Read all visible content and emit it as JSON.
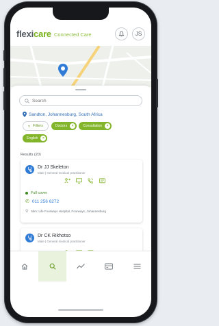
{
  "app": {
    "brand_flexi": "flexi",
    "brand_care": "care",
    "brand_sub": "Connected Care",
    "user_initials": "JS"
  },
  "search": {
    "placeholder": "Search",
    "value": ""
  },
  "location": {
    "text": "Sandton, Johannesburg, South Africa"
  },
  "filters": {
    "button_label": "Filters",
    "active_chips": [
      "Doctors",
      "Consultation",
      "English"
    ]
  },
  "results": {
    "label": "Results (20)"
  },
  "doctors": [
    {
      "name": "Dr JJ Skeleton",
      "subtitle": "Male | General medical practitioner",
      "cover": "Full cover",
      "phone": "011 256 6272",
      "address": "5km: Life Fourways Hospital, Fourways, Johannesburg"
    },
    {
      "name": "Dr CK Rikhotso",
      "subtitle": "Male | General medical practitioner"
    }
  ],
  "nav": {
    "items": [
      "home-icon",
      "search-icon",
      "activity-icon",
      "card-icon",
      "menu-icon"
    ],
    "active": "search-icon"
  },
  "colors": {
    "brand_green": "#7ab51d",
    "chip_green": "#82b52a",
    "link_blue": "#2f7bd6",
    "cover_green": "#3d8b1c"
  }
}
